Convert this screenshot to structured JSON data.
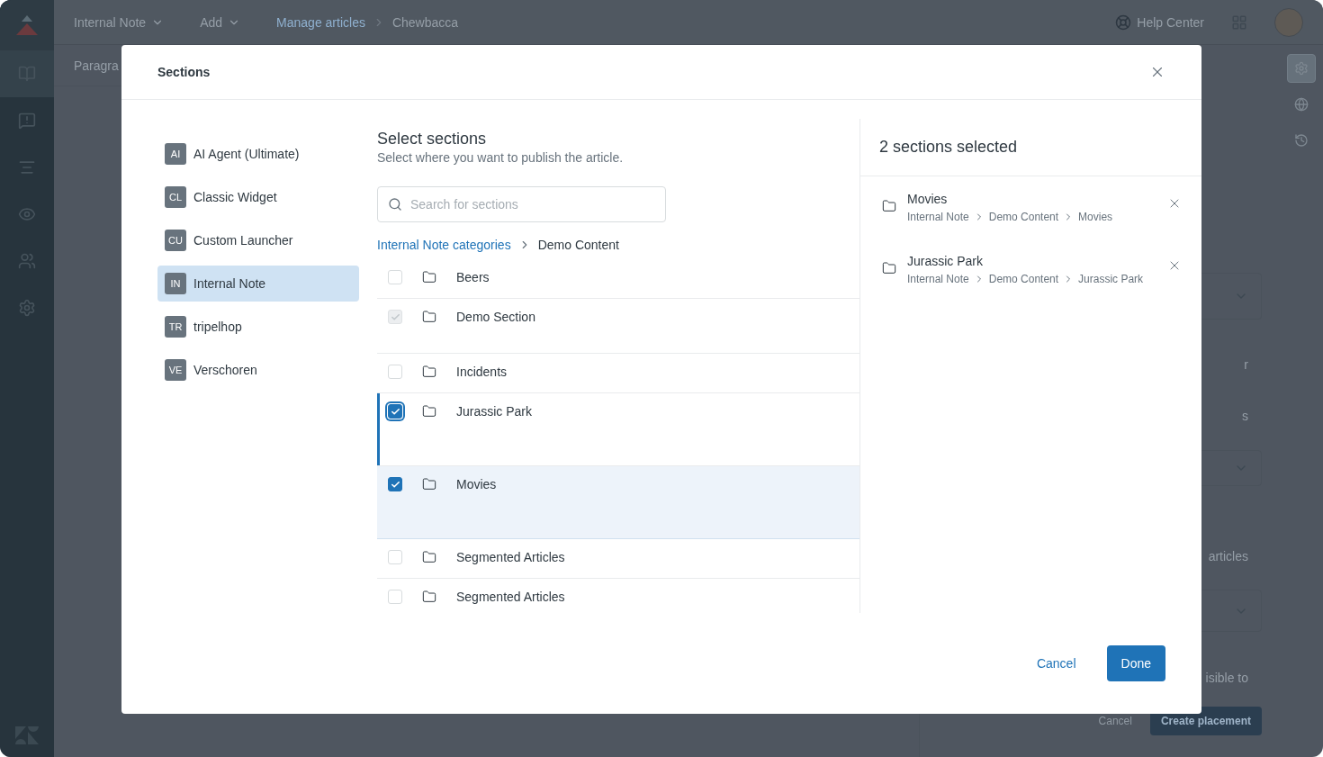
{
  "app": {
    "topbar": {
      "menus": [
        {
          "label": "Internal Note"
        },
        {
          "label": "Add"
        }
      ],
      "breadcrumb": [
        {
          "label": "Manage articles",
          "kind": "link"
        },
        {
          "label": "Chewbacca",
          "kind": "current"
        }
      ],
      "help": "Help Center"
    },
    "nav": [
      {
        "kind": "articles",
        "selected": true
      },
      {
        "kind": "alerts",
        "selected": false
      },
      {
        "kind": "list",
        "selected": false
      },
      {
        "kind": "preview",
        "selected": false
      },
      {
        "kind": "users",
        "selected": false
      },
      {
        "kind": "settings",
        "selected": false
      }
    ],
    "editor": {
      "toolbar_text": "Paragra"
    },
    "side_panel": {
      "items": [
        {
          "kind": "dropdown"
        },
        {
          "kind": "text",
          "text": "r"
        },
        {
          "kind": "text",
          "text": "s"
        },
        {
          "kind": "dropdown"
        },
        {
          "kind": "text",
          "text": "articles"
        },
        {
          "kind": "dropdown"
        },
        {
          "kind": "text",
          "text": "isible to"
        }
      ],
      "cancel": "Cancel",
      "create": "Create placement"
    },
    "tools": [
      {
        "kind": "settings",
        "selected": true
      },
      {
        "kind": "globe",
        "selected": false
      },
      {
        "kind": "history",
        "selected": false
      }
    ]
  },
  "dialog": {
    "title": "Sections",
    "brands": [
      {
        "initials": "AI",
        "label": "AI Agent (Ultimate)",
        "selected": false
      },
      {
        "initials": "CL",
        "label": "Classic Widget",
        "selected": false
      },
      {
        "initials": "CU",
        "label": "Custom Launcher",
        "selected": false
      },
      {
        "initials": "IN",
        "label": "Internal Note",
        "selected": true
      },
      {
        "initials": "TR",
        "label": "tripelhop",
        "selected": false
      },
      {
        "initials": "VE",
        "label": "Verschoren",
        "selected": false
      }
    ],
    "heading": "Select sections",
    "subheading": "Select where you want to publish the article.",
    "search": {
      "placeholder": "Search for sections"
    },
    "breadcrumb": [
      {
        "label": "Internal Note categories",
        "kind": "link"
      },
      {
        "label": "Demo Content",
        "kind": "current"
      }
    ],
    "sections": [
      {
        "label": "Beers",
        "checked": false,
        "disabled": false,
        "focused": false,
        "hovered": false,
        "tall": false
      },
      {
        "label": "Demo Section",
        "checked": true,
        "disabled": true,
        "focused": false,
        "hovered": false,
        "tall": true
      },
      {
        "label": "Incidents",
        "checked": false,
        "disabled": false,
        "focused": false,
        "hovered": false,
        "tall": false
      },
      {
        "label": "Jurassic Park",
        "checked": true,
        "disabled": false,
        "focused": true,
        "hovered": false,
        "tall": true
      },
      {
        "label": "Movies",
        "checked": true,
        "disabled": false,
        "focused": false,
        "hovered": true,
        "tall": true
      },
      {
        "label": "Segmented Articles",
        "checked": false,
        "disabled": false,
        "focused": false,
        "hovered": false,
        "tall": false
      },
      {
        "label": "Segmented Articles",
        "checked": false,
        "disabled": false,
        "focused": false,
        "hovered": false,
        "tall": false
      }
    ],
    "selected_title": "2 sections selected",
    "selected": [
      {
        "name": "Movies",
        "path": [
          "Internal Note",
          "Demo Content",
          "Movies"
        ]
      },
      {
        "name": "Jurassic Park",
        "path": [
          "Internal Note",
          "Demo Content",
          "Jurassic Park"
        ]
      }
    ],
    "cancel": "Cancel",
    "done": "Done"
  }
}
